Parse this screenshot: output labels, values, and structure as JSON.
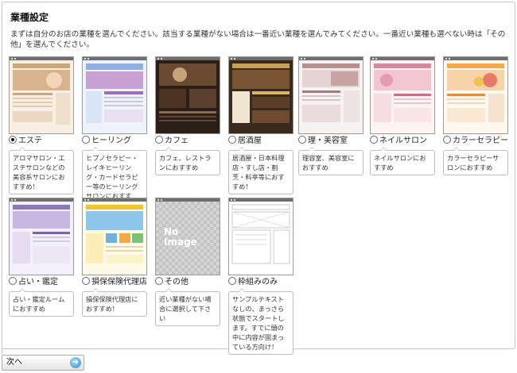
{
  "title": "業種設定",
  "description": "まずは自分のお店の業種を選んでください。該当する業種がない場合は一番近い業種を選んでみてください。一番近い業種も選べない時は「その他」を選んでください。",
  "options": [
    {
      "label": "エステ",
      "selected": true,
      "desc": "アロマサロン・エステサロンなどの美容系サロンにおすすめ！"
    },
    {
      "label": "ヒーリング",
      "selected": false,
      "desc": "ヒプノセラピー・レイキヒーリング・カードセラピー等のヒーリングサロンにおすすめ！"
    },
    {
      "label": "カフェ",
      "selected": false,
      "desc": "カフェ、レストランにおすすめ"
    },
    {
      "label": "居酒屋",
      "selected": false,
      "desc": "居酒屋・日本料理店・すし店・割烹・料亭等におすすめ！"
    },
    {
      "label": "理・美容室",
      "selected": false,
      "desc": "理容室、美容室におすすめ"
    },
    {
      "label": "ネイルサロン",
      "selected": false,
      "desc": "ネイルサロンにおすすめ"
    },
    {
      "label": "カラーセラピー",
      "selected": false,
      "desc": "カラーセラピーサロンにおすすめ"
    },
    {
      "label": "占い・鑑定",
      "selected": false,
      "desc": "占い・鑑定ルームにおすすめ"
    },
    {
      "label": "損保保険代理店",
      "selected": false,
      "desc": "損保保険代理店におすすめ！"
    },
    {
      "label": "その他",
      "selected": false,
      "desc": "近い業種がない場合に選択して下さい"
    },
    {
      "label": "枠組みのみ",
      "selected": false,
      "desc": "サンプルテキストなしの、まっさら状態でスタートします。すでに頭の中に内容が固まっている方向け！"
    }
  ],
  "no_image_text": "No Image",
  "next_button": "次へ",
  "colors": {
    "border": "#c8c8c8",
    "accent": "#2f8fd0"
  }
}
